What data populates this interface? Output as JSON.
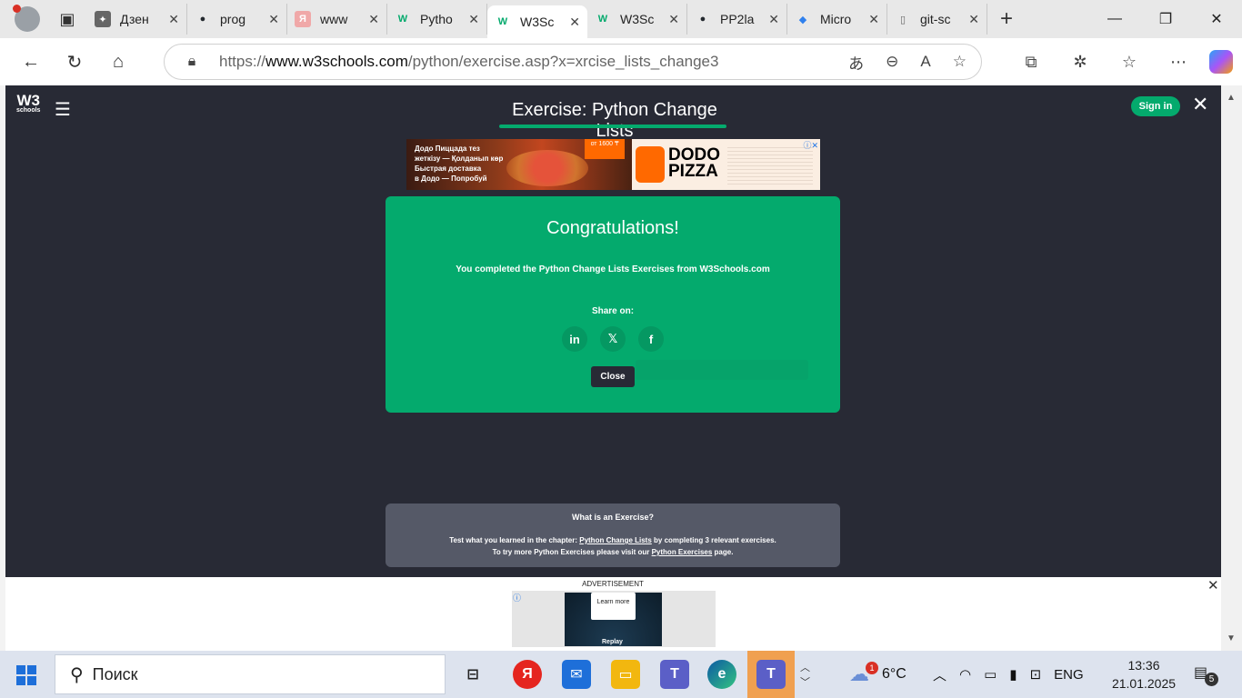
{
  "browser": {
    "tabs": [
      {
        "title": "Дзен",
        "favicon": "dzen-icon",
        "fav_glyph": "✦",
        "fav_bg": "#666666",
        "fav_color": "#ffffff"
      },
      {
        "title": "prog",
        "favicon": "github-icon",
        "fav_glyph": "●",
        "fav_bg": "transparent",
        "fav_color": "#24292f"
      },
      {
        "title": "www",
        "favicon": "yandex-icon",
        "fav_glyph": "Я",
        "fav_bg": "#f0a8a8",
        "fav_color": "#ffffff"
      },
      {
        "title": "Pytho",
        "favicon": "w3schools-icon",
        "fav_glyph": "W",
        "fav_bg": "transparent",
        "fav_color": "#04aa6d"
      },
      {
        "title": "W3Sc",
        "favicon": "w3schools-icon",
        "fav_glyph": "W",
        "fav_bg": "transparent",
        "fav_color": "#04aa6d",
        "active": true
      },
      {
        "title": "W3Sc",
        "favicon": "w3schools-icon",
        "fav_glyph": "W",
        "fav_bg": "transparent",
        "fav_color": "#04aa6d"
      },
      {
        "title": "PP2la",
        "favicon": "github-icon",
        "fav_glyph": "●",
        "fav_bg": "transparent",
        "fav_color": "#24292f"
      },
      {
        "title": "Micro",
        "favicon": "vscode-icon",
        "fav_glyph": "◆",
        "fav_bg": "transparent",
        "fav_color": "#2f80ed"
      },
      {
        "title": "git-sc",
        "favicon": "page-icon",
        "fav_glyph": "▯",
        "fav_bg": "transparent",
        "fav_color": "#666666"
      }
    ],
    "url_prefix": "https://",
    "url_host": "www.w3schools.com",
    "url_path": "/python/exercise.asp?x=xrcise_lists_change3"
  },
  "page": {
    "logo_text": "W3",
    "logo_sub": "schools",
    "title": "Exercise: Python Change Lists",
    "signin_label": "Sign in",
    "ad_top": {
      "line1": "Додо Пиццада тез",
      "line2": "жеткізу — Қолданып көр",
      "line3": "Быстрая доставка",
      "line4": "в Додо — Попробуй",
      "badge": "от 1600 ₸",
      "brand_line1": "DODO",
      "brand_line2": "PIZZA"
    },
    "congrats": {
      "heading": "Congratulations!",
      "message": "You completed the Python Change Lists Exercises from W3Schools.com",
      "share_label": "Share on:",
      "close_label": "Close"
    },
    "whatis": {
      "heading": "What is an Exercise?",
      "line1_a": "Test what you learned in the chapter: ",
      "line1_link": "Python Change Lists",
      "line1_b": " by completing 3 relevant exercises.",
      "line2_a": "To try more Python Exercises please visit our ",
      "line2_link": "Python Exercises",
      "line2_b": " page."
    },
    "ad_bottom": {
      "label": "ADVERTISEMENT",
      "learn_more": "Learn more",
      "replay": "Replay"
    }
  },
  "taskbar": {
    "search_placeholder": "Поиск",
    "weather": "6°C",
    "lang": "ENG",
    "time": "13:36",
    "date": "21.01.2025",
    "weather_badge": "1",
    "notif_count": "5"
  },
  "colors": {
    "accent": "#04aa6d",
    "page_bg": "#282a35",
    "panel_gray": "#555967"
  }
}
